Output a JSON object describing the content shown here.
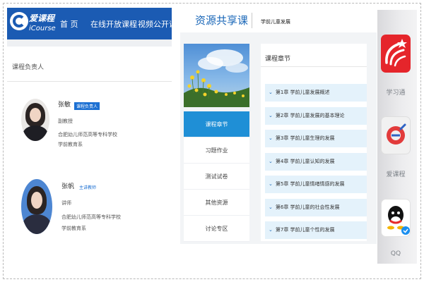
{
  "left_panel": {
    "brand": {
      "name_cn": "爱课程",
      "name_en": "iCourse"
    },
    "nav": [
      "首 页",
      "在线开放课程",
      "视频公开课"
    ],
    "section_title": "课程负责人",
    "teachers": [
      {
        "name": "张敏",
        "badge": "课程负责人",
        "title": "副教授",
        "org": "合肥幼儿师范高等专科学校",
        "dept": "学前教育系"
      },
      {
        "name": "张帆",
        "badge": "主讲教师",
        "title": "讲师",
        "org": "合肥幼儿师范高等专科学校",
        "dept": "学前教育系"
      }
    ]
  },
  "middle_panel": {
    "title": "资源共享课",
    "course_name": "学前儿童发展",
    "side_menu": [
      "课程章节",
      "习题作业",
      "测试试卷",
      "其他资源",
      "讨论专区"
    ],
    "active_menu_index": 0,
    "chapters_title": "课程章节",
    "chapters": [
      "第1章 学前儿童发展概述",
      "第2章 学前儿童发展的基本理论",
      "第3章 学前儿童生理的发展",
      "第4章 学前儿童认知的发展",
      "第5章 学前儿童情绪情感的发展",
      "第6章 学前儿童的社会性发展",
      "第7章 学前儿童个性的发展"
    ]
  },
  "phone_apps": [
    {
      "label": "学习通",
      "icon": "xuexitong-icon"
    },
    {
      "label": "爱课程",
      "icon": "icourse-app-icon"
    },
    {
      "label": "QQ",
      "icon": "qq-icon"
    }
  ],
  "colors": {
    "brand_blue": "#1b5bb3",
    "active_blue": "#1f8fd6",
    "chapter_bg": "#e4f2fb",
    "xuexitong_red": "#e5252b"
  }
}
